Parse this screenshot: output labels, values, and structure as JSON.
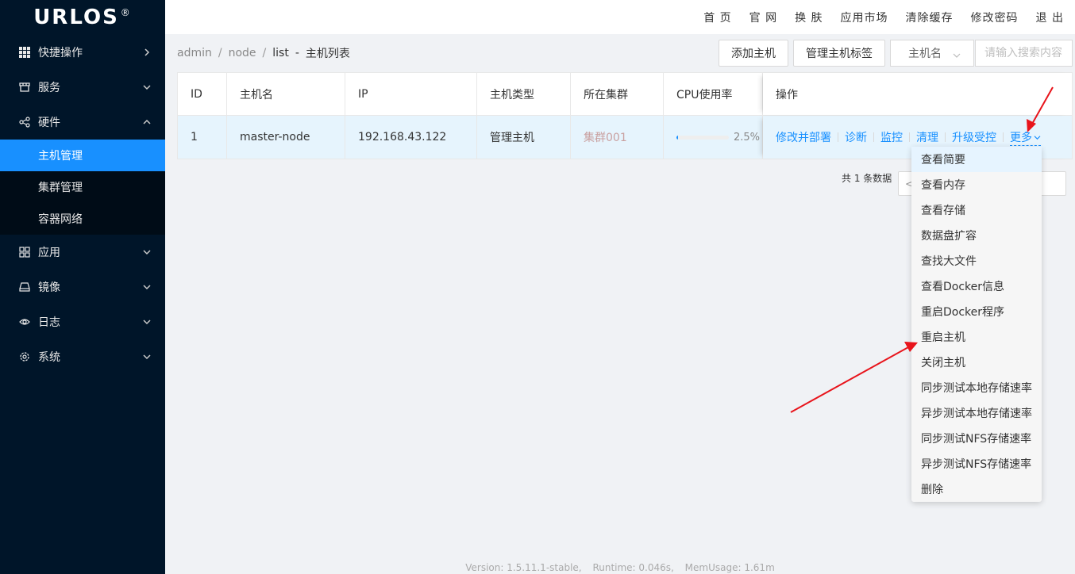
{
  "logo": {
    "text": "URLOS",
    "mark": "®"
  },
  "sidebar": {
    "items": [
      {
        "label": "快捷操作",
        "icon": "grid-icon",
        "arrow": "right"
      },
      {
        "label": "服务",
        "icon": "store-icon",
        "arrow": "down"
      },
      {
        "label": "硬件",
        "icon": "share-icon",
        "arrow": "up",
        "children": [
          "主机管理",
          "集群管理",
          "容器网络"
        ]
      },
      {
        "label": "应用",
        "icon": "apps-icon",
        "arrow": "down"
      },
      {
        "label": "镜像",
        "icon": "disk-icon",
        "arrow": "down"
      },
      {
        "label": "日志",
        "icon": "eye-icon",
        "arrow": "down"
      },
      {
        "label": "系统",
        "icon": "gear-icon",
        "arrow": "down"
      }
    ],
    "active_child": "主机管理"
  },
  "topnav": [
    "首 页",
    "官 网",
    "换 肤",
    "应用市场",
    "清除缓存",
    "修改密码",
    "退 出"
  ],
  "breadcrumb": {
    "items": [
      "admin",
      "node",
      "list"
    ],
    "current": "主机列表"
  },
  "toolbar": {
    "add_host": "添加主机",
    "manage_tags": "管理主机标签",
    "select_value": "主机名",
    "search_placeholder": "请输入搜索内容"
  },
  "table": {
    "columns": [
      "ID",
      "主机名",
      "IP",
      "主机类型",
      "所在集群",
      "CPU使用率",
      "操作"
    ],
    "rows": [
      {
        "id": "1",
        "name": "master-node",
        "ip": "192.168.43.122",
        "type": "管理主机",
        "cluster": "集群001",
        "cpu_percent": 2.5,
        "cpu_label": "2.5%"
      }
    ],
    "ops": [
      "修改并部署",
      "诊断",
      "监控",
      "清理",
      "升级受控",
      "更多"
    ]
  },
  "pagination": {
    "total_text": "共 1 条数据",
    "prev": "<"
  },
  "more_menu": [
    "查看简要",
    "查看内存",
    "查看存储",
    "数据盘扩容",
    "查找大文件",
    "查看Docker信息",
    "重启Docker程序",
    "重启主机",
    "关闭主机",
    "同步测试本地存储速率",
    "异步测试本地存储速率",
    "同步测试NFS存储速率",
    "异步测试NFS存储速率",
    "删除"
  ],
  "footer": {
    "version": "Version: 1.5.11.1-stable,",
    "runtime": "Runtime: 0.046s,",
    "mem": "MemUsage: 1.61m"
  },
  "colors": {
    "sidebar_bg": "#001529",
    "accent": "#1890ff",
    "row_highlight": "#e6f4fd",
    "annotation_arrow": "#e8141b"
  }
}
